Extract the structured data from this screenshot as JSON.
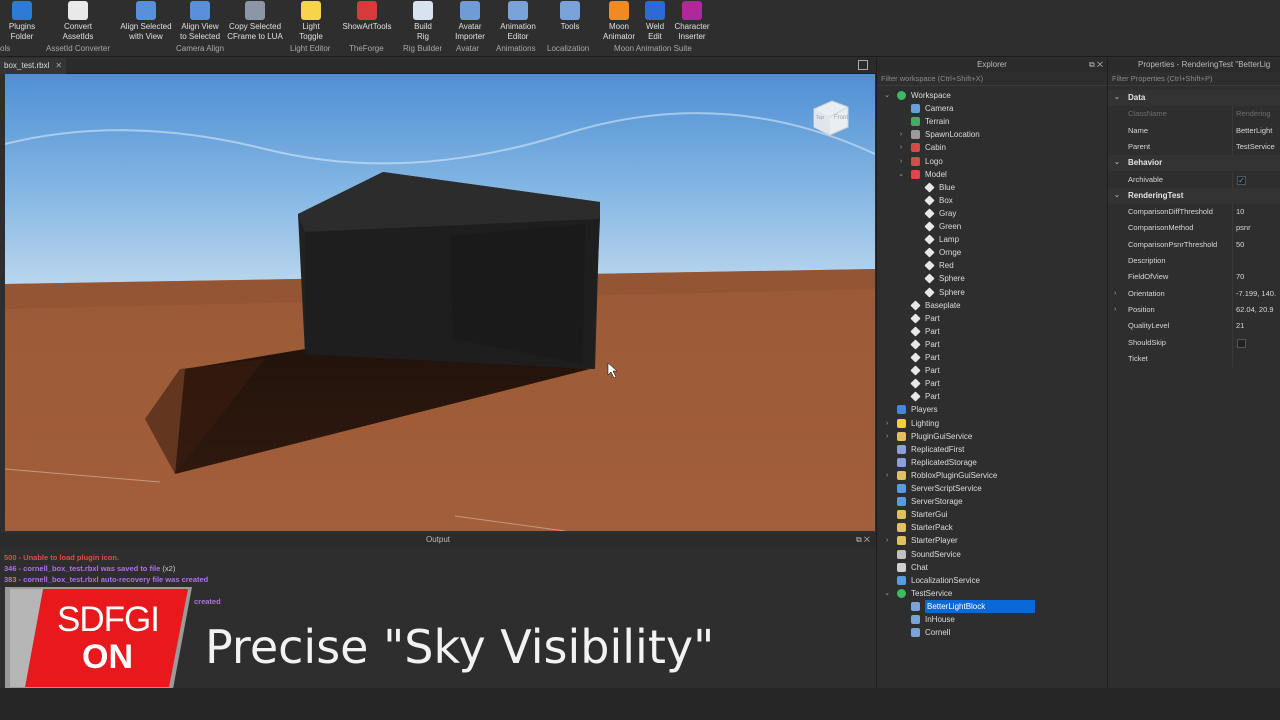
{
  "ribbon": {
    "tools": [
      {
        "label": "Plugins\nFolder",
        "icon": "folder-icon",
        "color": "#2c7cd6"
      },
      {
        "label": "Convert\nAssetIds",
        "icon": "convert-icon",
        "color": "#e9e9e9"
      },
      {
        "label": "Align Selected\nwith View",
        "icon": "align-icon",
        "color": "#5a8fdc"
      },
      {
        "label": "Align View\nto Selected",
        "icon": "align-view-icon",
        "color": "#5a8fdc"
      },
      {
        "label": "Copy Selected\nCFrame to LUA",
        "icon": "copy-icon",
        "color": "#8b96a8"
      },
      {
        "label": "Light\nToggle",
        "icon": "lightbulb-icon",
        "color": "#f6d44b"
      },
      {
        "label": "ShowArtTools",
        "icon": "close-circle-icon",
        "color": "#d63a3a"
      },
      {
        "label": "Build\nRig",
        "icon": "rig-icon",
        "color": "#d9e2f0"
      },
      {
        "label": "Avatar\nImporter",
        "icon": "avatar-icon",
        "color": "#6f9bd6"
      },
      {
        "label": "Animation\nEditor",
        "icon": "animation-icon",
        "color": "#7aa4d8"
      },
      {
        "label": "Tools",
        "icon": "globe-icon",
        "color": "#7aa4d8"
      },
      {
        "label": "Moon\nAnimator",
        "icon": "moon-icon",
        "color": "#f08a24"
      },
      {
        "label": "Weld\nEdit",
        "icon": "weld-icon",
        "color": "#2d6ad6"
      },
      {
        "label": "Character\nInserter",
        "icon": "character-icon",
        "color": "#b0289a"
      }
    ],
    "groups": [
      "ols",
      "AssetId Converter",
      "Camera Align",
      "Light Editor",
      "TheForge",
      "Rig Builder",
      "Avatar",
      "Animations",
      "Localization",
      "Moon Animation Suite"
    ]
  },
  "viewport": {
    "tab_label": "box_test.rbxl",
    "cube_label": "Front",
    "cube_side_label": "Top"
  },
  "output": {
    "title": "Output",
    "lines": [
      {
        "text": "500 - Unable to load plugin icon.",
        "color": "#e04b4b"
      },
      {
        "text": "346 - cornell_box_test.rbxl was saved to file",
        "suffix": "(x2)",
        "color": "#b070e8"
      },
      {
        "text": "383 - cornell_box_test.rbxl auto-recovery file was created",
        "color": "#b070e8"
      },
      {
        "text": "created",
        "color": "#b070e8"
      }
    ]
  },
  "overlay": {
    "badge_line1": "SDFGI",
    "badge_line2": "ON",
    "caption": "Precise \"Sky Visibility\""
  },
  "explorer": {
    "title": "Explorer",
    "filter_placeholder": "Filter workspace (Ctrl+Shift+X)",
    "items": [
      {
        "label": "Workspace",
        "depth": 0,
        "arrow": "⌄",
        "icon": "workspace-icon",
        "color": "#3dbb63"
      },
      {
        "label": "Camera",
        "depth": 1,
        "arrow": "",
        "icon": "camera-icon",
        "color": "#6aa0d8"
      },
      {
        "label": "Terrain",
        "depth": 1,
        "arrow": "",
        "icon": "terrain-icon",
        "color": "#4aa86a"
      },
      {
        "label": "SpawnLocation",
        "depth": 1,
        "arrow": "›",
        "icon": "spawn-icon",
        "color": "#9a9a9a"
      },
      {
        "label": "Cabin",
        "depth": 1,
        "arrow": "›",
        "icon": "model-icon",
        "color": "#d64a4a"
      },
      {
        "label": "Logo",
        "depth": 1,
        "arrow": "›",
        "icon": "model-icon",
        "color": "#d64a4a"
      },
      {
        "label": "Model",
        "depth": 1,
        "arrow": "⌄",
        "icon": "model-icon",
        "color": "#d64a4a"
      },
      {
        "label": "Blue",
        "depth": 2,
        "arrow": "",
        "icon": "part-icon",
        "color": "#e8e8e8"
      },
      {
        "label": "Box",
        "depth": 2,
        "arrow": "",
        "icon": "part-icon",
        "color": "#e8e8e8"
      },
      {
        "label": "Gray",
        "depth": 2,
        "arrow": "",
        "icon": "part-icon",
        "color": "#e8e8e8"
      },
      {
        "label": "Green",
        "depth": 2,
        "arrow": "",
        "icon": "part-icon",
        "color": "#e8e8e8"
      },
      {
        "label": "Lamp",
        "depth": 2,
        "arrow": "",
        "icon": "part-icon",
        "color": "#e8e8e8"
      },
      {
        "label": "Ornge",
        "depth": 2,
        "arrow": "",
        "icon": "part-icon",
        "color": "#e8e8e8"
      },
      {
        "label": "Red",
        "depth": 2,
        "arrow": "",
        "icon": "part-icon",
        "color": "#e8e8e8"
      },
      {
        "label": "Sphere",
        "depth": 2,
        "arrow": "",
        "icon": "part-icon",
        "color": "#e8e8e8"
      },
      {
        "label": "Sphere",
        "depth": 2,
        "arrow": "",
        "icon": "part-icon",
        "color": "#e8e8e8"
      },
      {
        "label": "Baseplate",
        "depth": 1,
        "arrow": "",
        "icon": "part-icon",
        "color": "#e8e8e8"
      },
      {
        "label": "Part",
        "depth": 1,
        "arrow": "",
        "icon": "part-icon",
        "color": "#e8e8e8"
      },
      {
        "label": "Part",
        "depth": 1,
        "arrow": "",
        "icon": "part-icon",
        "color": "#e8e8e8"
      },
      {
        "label": "Part",
        "depth": 1,
        "arrow": "",
        "icon": "part-icon",
        "color": "#e8e8e8"
      },
      {
        "label": "Part",
        "depth": 1,
        "arrow": "",
        "icon": "part-icon",
        "color": "#e8e8e8"
      },
      {
        "label": "Part",
        "depth": 1,
        "arrow": "",
        "icon": "part-icon",
        "color": "#e8e8e8"
      },
      {
        "label": "Part",
        "depth": 1,
        "arrow": "",
        "icon": "part-icon",
        "color": "#e8e8e8"
      },
      {
        "label": "Part",
        "depth": 1,
        "arrow": "",
        "icon": "part-icon",
        "color": "#e8e8e8"
      },
      {
        "label": "Players",
        "depth": 0,
        "arrow": "",
        "icon": "players-icon",
        "color": "#4a86d8"
      },
      {
        "label": "Lighting",
        "depth": 0,
        "arrow": "›",
        "icon": "lightbulb-icon",
        "color": "#f3cf3a"
      },
      {
        "label": "PluginGuiService",
        "depth": 0,
        "arrow": "›",
        "icon": "folder-icon",
        "color": "#e0c060"
      },
      {
        "label": "ReplicatedFirst",
        "depth": 0,
        "arrow": "",
        "icon": "replicated-icon",
        "color": "#8c9fd8"
      },
      {
        "label": "ReplicatedStorage",
        "depth": 0,
        "arrow": "",
        "icon": "replicated-icon",
        "color": "#8c9fd8"
      },
      {
        "label": "RobloxPluginGuiService",
        "depth": 0,
        "arrow": "›",
        "icon": "folder-icon",
        "color": "#e0c060"
      },
      {
        "label": "ServerScriptService",
        "depth": 0,
        "arrow": "",
        "icon": "server-icon",
        "color": "#5a9be0"
      },
      {
        "label": "ServerStorage",
        "depth": 0,
        "arrow": "",
        "icon": "server-icon",
        "color": "#5a9be0"
      },
      {
        "label": "StarterGui",
        "depth": 0,
        "arrow": "",
        "icon": "folder-icon",
        "color": "#e0c060"
      },
      {
        "label": "StarterPack",
        "depth": 0,
        "arrow": "",
        "icon": "folder-icon",
        "color": "#e0c060"
      },
      {
        "label": "StarterPlayer",
        "depth": 0,
        "arrow": "›",
        "icon": "folder-icon",
        "color": "#e0c060"
      },
      {
        "label": "SoundService",
        "depth": 0,
        "arrow": "",
        "icon": "sound-icon",
        "color": "#c0c0c0"
      },
      {
        "label": "Chat",
        "depth": 0,
        "arrow": "",
        "icon": "chat-icon",
        "color": "#d0d0d0"
      },
      {
        "label": "LocalizationService",
        "depth": 0,
        "arrow": "",
        "icon": "globe-icon",
        "color": "#5a9be0"
      },
      {
        "label": "TestService",
        "depth": 0,
        "arrow": "⌄",
        "icon": "check-icon",
        "color": "#3dbb63"
      },
      {
        "label": "BetterLightBlock",
        "depth": 1,
        "arrow": "",
        "icon": "module-icon",
        "color": "#7aa4d8",
        "selected": true
      },
      {
        "label": "InHouse",
        "depth": 1,
        "arrow": "",
        "icon": "module-icon",
        "color": "#7aa4d8"
      },
      {
        "label": "Cornell",
        "depth": 1,
        "arrow": "",
        "icon": "module-icon",
        "color": "#7aa4d8"
      }
    ]
  },
  "properties": {
    "title": "Properties - RenderingTest \"BetterLig",
    "filter_placeholder": "Filter Properties (Ctrl+Shift+P)",
    "rows": [
      {
        "type": "cat",
        "name": "Data"
      },
      {
        "type": "prop",
        "name": "ClassName",
        "value": "Rendering",
        "dim": true
      },
      {
        "type": "prop",
        "name": "Name",
        "value": "BetterLight"
      },
      {
        "type": "prop",
        "name": "Parent",
        "value": "TestService"
      },
      {
        "type": "cat",
        "name": "Behavior"
      },
      {
        "type": "bool",
        "name": "Archivable",
        "value": "✓"
      },
      {
        "type": "cat",
        "name": "RenderingTest"
      },
      {
        "type": "prop",
        "name": "ComparisonDiffThreshold",
        "value": "10"
      },
      {
        "type": "prop",
        "name": "ComparisonMethod",
        "value": "psnr"
      },
      {
        "type": "prop",
        "name": "ComparisonPsnrThreshold",
        "value": "50"
      },
      {
        "type": "prop",
        "name": "Description",
        "value": ""
      },
      {
        "type": "prop",
        "name": "FieldOfView",
        "value": "70"
      },
      {
        "type": "prop",
        "name": "Orientation",
        "value": "-7.199, 140.",
        "expandable": true
      },
      {
        "type": "prop",
        "name": "Position",
        "value": "62.04, 20.9",
        "expandable": true
      },
      {
        "type": "prop",
        "name": "QualityLevel",
        "value": "21"
      },
      {
        "type": "bool",
        "name": "ShouldSkip",
        "value": ""
      },
      {
        "type": "prop",
        "name": "Ticket",
        "value": ""
      }
    ]
  }
}
